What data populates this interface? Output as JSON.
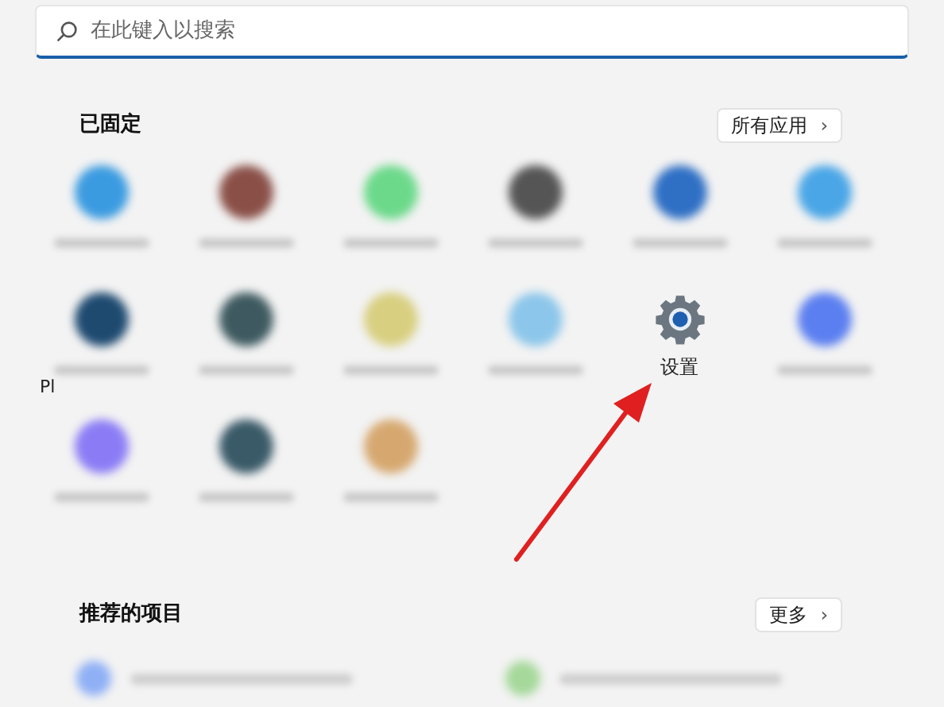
{
  "search": {
    "placeholder": "在此键入以搜索"
  },
  "pinned": {
    "title": "已固定",
    "button": "所有应用",
    "button_icon": "›",
    "apps": [
      {
        "kind": "blurred",
        "color": "#3b9be0"
      },
      {
        "kind": "blurred",
        "color": "#8a5048"
      },
      {
        "kind": "blurred",
        "color": "#6cd98a"
      },
      {
        "kind": "blurred",
        "color": "#555555"
      },
      {
        "kind": "blurred",
        "color": "#2f6fc4"
      },
      {
        "kind": "blurred",
        "color": "#4aa6e6"
      },
      {
        "kind": "blurred",
        "color": "#1e4a70"
      },
      {
        "kind": "blurred",
        "color": "#3e5a60"
      },
      {
        "kind": "blurred",
        "color": "#d8cf80"
      },
      {
        "kind": "blurred",
        "color": "#8cc6ea"
      },
      {
        "kind": "settings",
        "label": "设置"
      },
      {
        "kind": "blurred",
        "color": "#5b7ff0"
      },
      {
        "kind": "blurred",
        "color": "#8b7cf5"
      },
      {
        "kind": "blurred",
        "color": "#3a5a68"
      },
      {
        "kind": "blurred",
        "color": "#d6a870"
      }
    ]
  },
  "stray_text": "Pl",
  "recommended": {
    "title": "推荐的项目",
    "button": "更多",
    "button_icon": "›",
    "items": [
      {
        "color": "#8fb0f5"
      },
      {
        "color": "#a5d89a"
      }
    ]
  }
}
